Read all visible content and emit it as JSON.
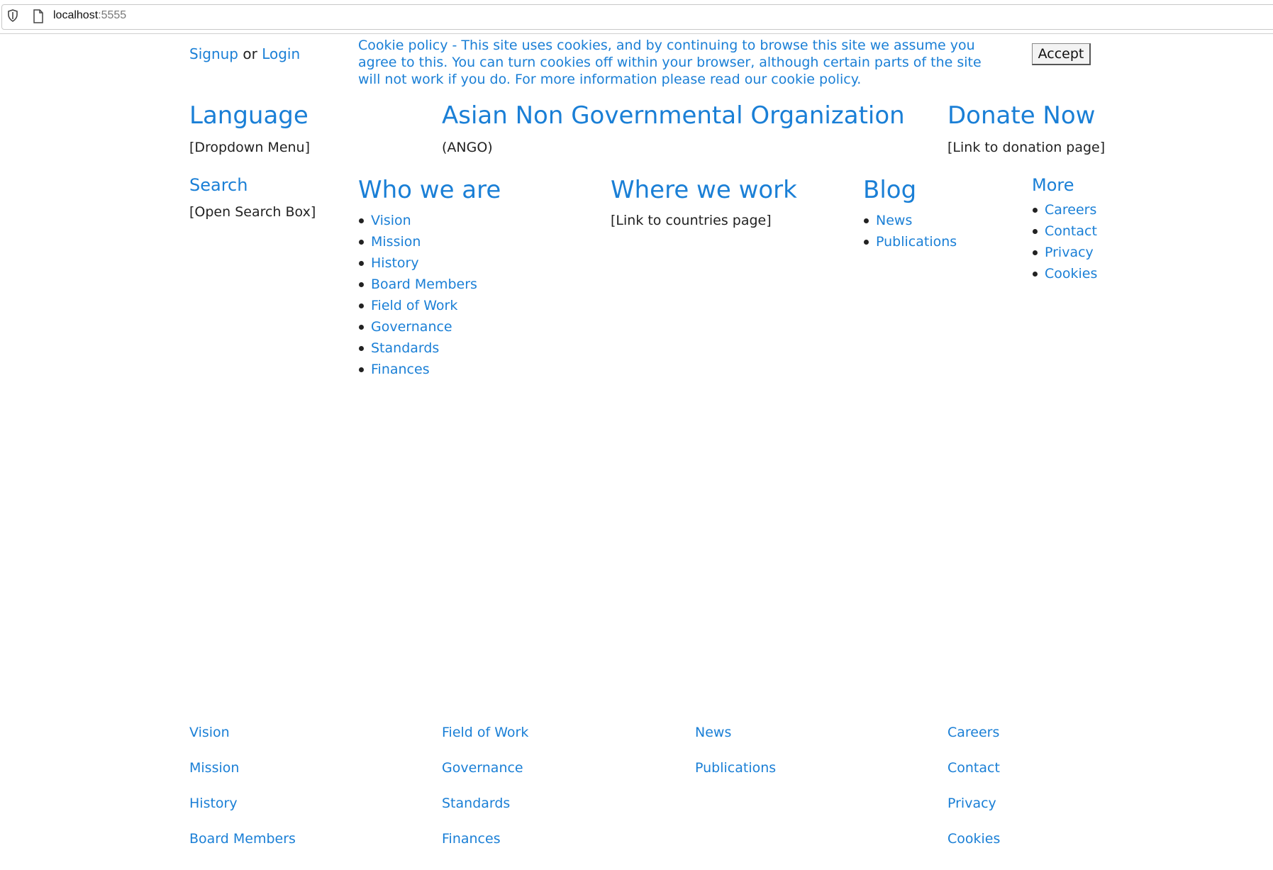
{
  "browser": {
    "url_host": "localhost",
    "url_port": ":5555"
  },
  "auth": {
    "signup": "Signup",
    "or": "or",
    "login": "Login"
  },
  "cookie_banner": {
    "text": "Cookie policy - This site uses cookies, and by continuing to browse this site we assume you agree to this. You can turn cookies off within your browser, although certain parts of the site will not work if you do. For more information please read our cookie policy.",
    "accept_label": "Accept"
  },
  "header": {
    "language_title": "Language",
    "language_note": "[Dropdown Menu]",
    "org_title": "Asian Non Governmental Organization",
    "org_abbr": "(ANGO)",
    "donate_title": "Donate Now",
    "donate_note": "[Link to donation page]"
  },
  "nav": {
    "search_title": "Search",
    "search_note": "[Open Search Box]",
    "who_we_are": {
      "title": "Who we are",
      "items": [
        "Vision",
        "Mission",
        "History",
        "Board Members",
        "Field of Work",
        "Governance",
        "Standards",
        "Finances"
      ]
    },
    "where_we_work": {
      "title": "Where we work",
      "note": "[Link to countries page]"
    },
    "blog": {
      "title": "Blog",
      "items": [
        "News",
        "Publications"
      ]
    },
    "more": {
      "title": "More",
      "items": [
        "Careers",
        "Contact",
        "Privacy",
        "Cookies"
      ]
    }
  },
  "footer": {
    "col1": [
      "Vision",
      "Mission",
      "History",
      "Board Members"
    ],
    "col2": [
      "Field of Work",
      "Governance",
      "Standards",
      "Finances"
    ],
    "col3": [
      "News",
      "Publications"
    ],
    "col4": [
      "Careers",
      "Contact",
      "Privacy",
      "Cookies"
    ]
  }
}
